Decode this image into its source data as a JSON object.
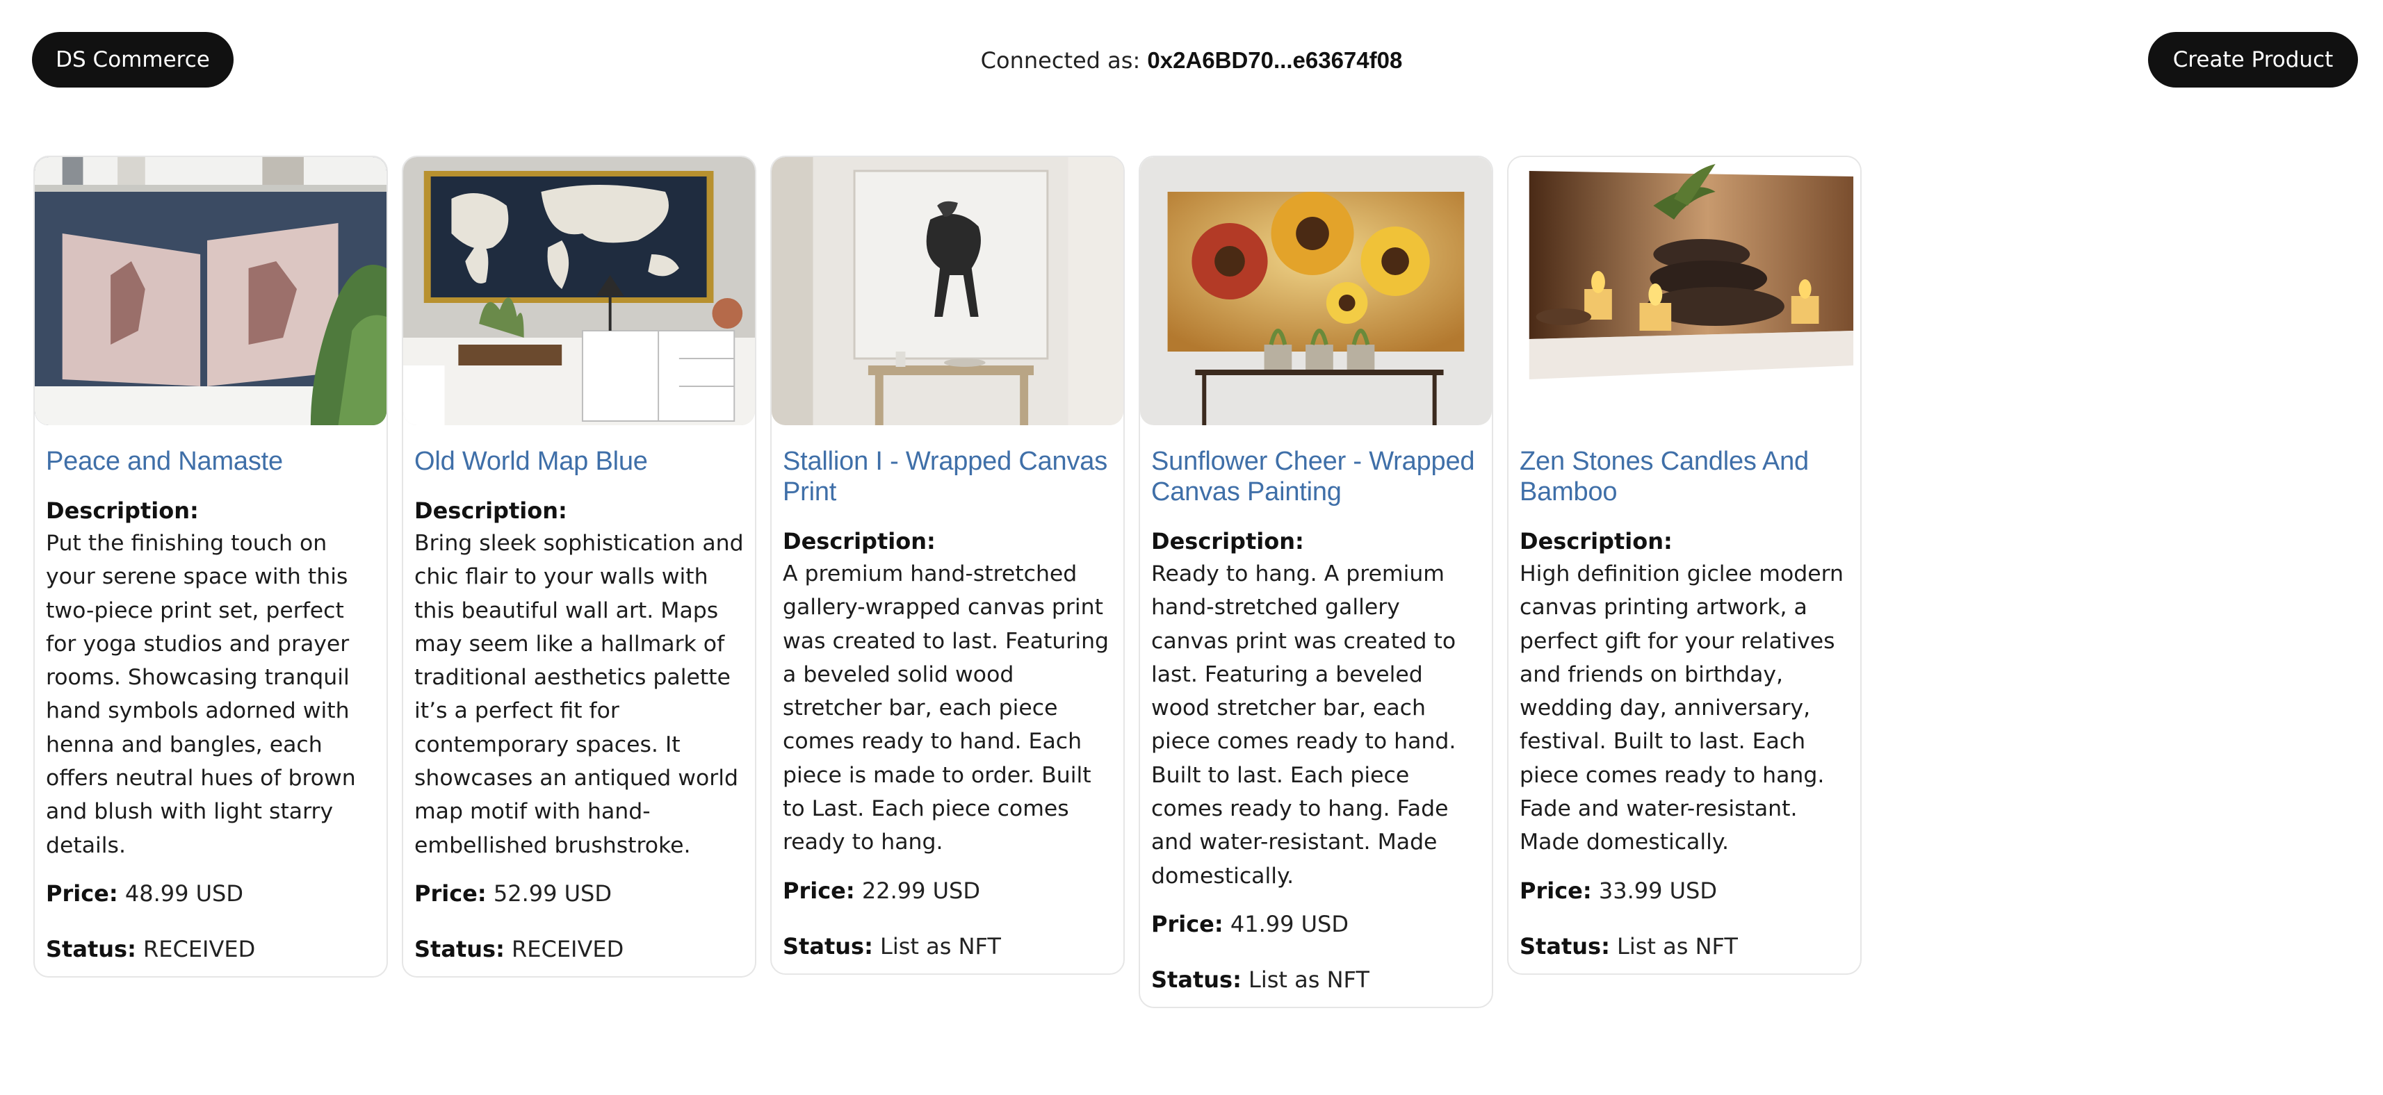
{
  "header": {
    "brand_label": "DS Commerce",
    "connected_prefix": "Connected as:",
    "connected_address": "0x2A6BD70...e63674f08",
    "create_label": "Create Product"
  },
  "labels": {
    "description": "Description:",
    "price": "Price:",
    "status": "Status:"
  },
  "colors": {
    "title_link": "#3f6fa8",
    "button_bg": "#111111",
    "button_text": "#ffffff",
    "card_border": "#e6e6e6"
  },
  "products": [
    {
      "title": "Peace and Namaste",
      "description": "Put the finishing touch on your serene space with this two-piece print set, perfect for yoga studios and prayer rooms. Showcasing tranquil hand symbols adorned with henna and bangles, each offers neutral hues of brown and blush with light starry details.",
      "price": "48.99 USD",
      "status": "RECEIVED"
    },
    {
      "title": "Old World Map Blue",
      "description": "Bring sleek sophistication and chic flair to your walls with this beautiful wall art. Maps may seem like a hallmark of traditional aesthetics palette it’s a perfect fit for contemporary spaces. It showcases an antiqued world map motif with hand-embellished brushstroke.",
      "price": "52.99 USD",
      "status": "RECEIVED"
    },
    {
      "title": "Stallion I - Wrapped Canvas Print",
      "description": "A premium hand-stretched gallery-wrapped canvas print was created to last. Featuring a beveled solid wood stretcher bar, each piece comes ready to hand. Each piece is made to order. Built to Last. Each piece comes ready to hang.",
      "price": "22.99 USD",
      "status": "List as NFT"
    },
    {
      "title": "Sunflower Cheer - Wrapped Canvas Painting",
      "description": "Ready to hang. A premium hand-stretched gallery canvas print was created to last. Featuring a beveled wood stretcher bar, each piece comes ready to hand. Built to last. Each piece comes ready to hang. Fade and water-resistant. Made domestically.",
      "price": "41.99 USD",
      "status": "List as NFT"
    },
    {
      "title": "Zen Stones Candles And Bamboo",
      "description": "High definition giclee modern canvas printing artwork, a perfect gift for your relatives and friends on birthday, wedding day, anniversary, festival. Built to last. Each piece comes ready to hang. Fade and water-resistant. Made domestically.",
      "price": "33.99 USD",
      "status": "List as NFT"
    }
  ]
}
